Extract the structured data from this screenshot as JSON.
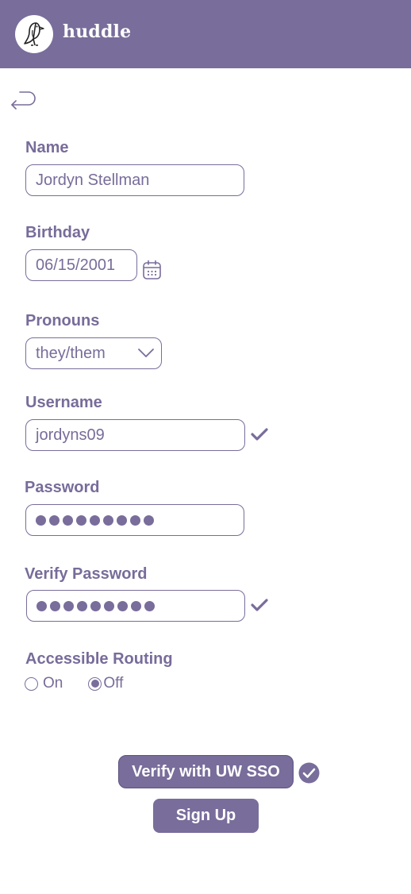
{
  "header": {
    "brand": "huddle",
    "logo_icon": "penguin-icon",
    "background": "#796d9b"
  },
  "back": {
    "icon": "back-arrow-icon"
  },
  "form": {
    "name": {
      "label": "Name",
      "value": "Jordyn Stellman"
    },
    "birthday": {
      "label": "Birthday",
      "value": "06/15/2001",
      "icon": "calendar-icon"
    },
    "pronouns": {
      "label": "Pronouns",
      "value": "they/them",
      "icon": "chevron-down-icon"
    },
    "username": {
      "label": "Username",
      "value": "jordyns09",
      "verified": true
    },
    "password": {
      "label": "Password",
      "masked_length": 9
    },
    "verify_password": {
      "label": "Verify Password",
      "masked_length": 9,
      "verified": true
    },
    "accessible_routing": {
      "label": "Accessible Routing",
      "options": [
        "On",
        "Off"
      ],
      "selected": "Off"
    }
  },
  "actions": {
    "sso_label": "Verify with UW SSO",
    "sso_verified": true,
    "signup_label": "Sign Up"
  },
  "colors": {
    "accent": "#796d9b",
    "text": "#786c9a"
  }
}
